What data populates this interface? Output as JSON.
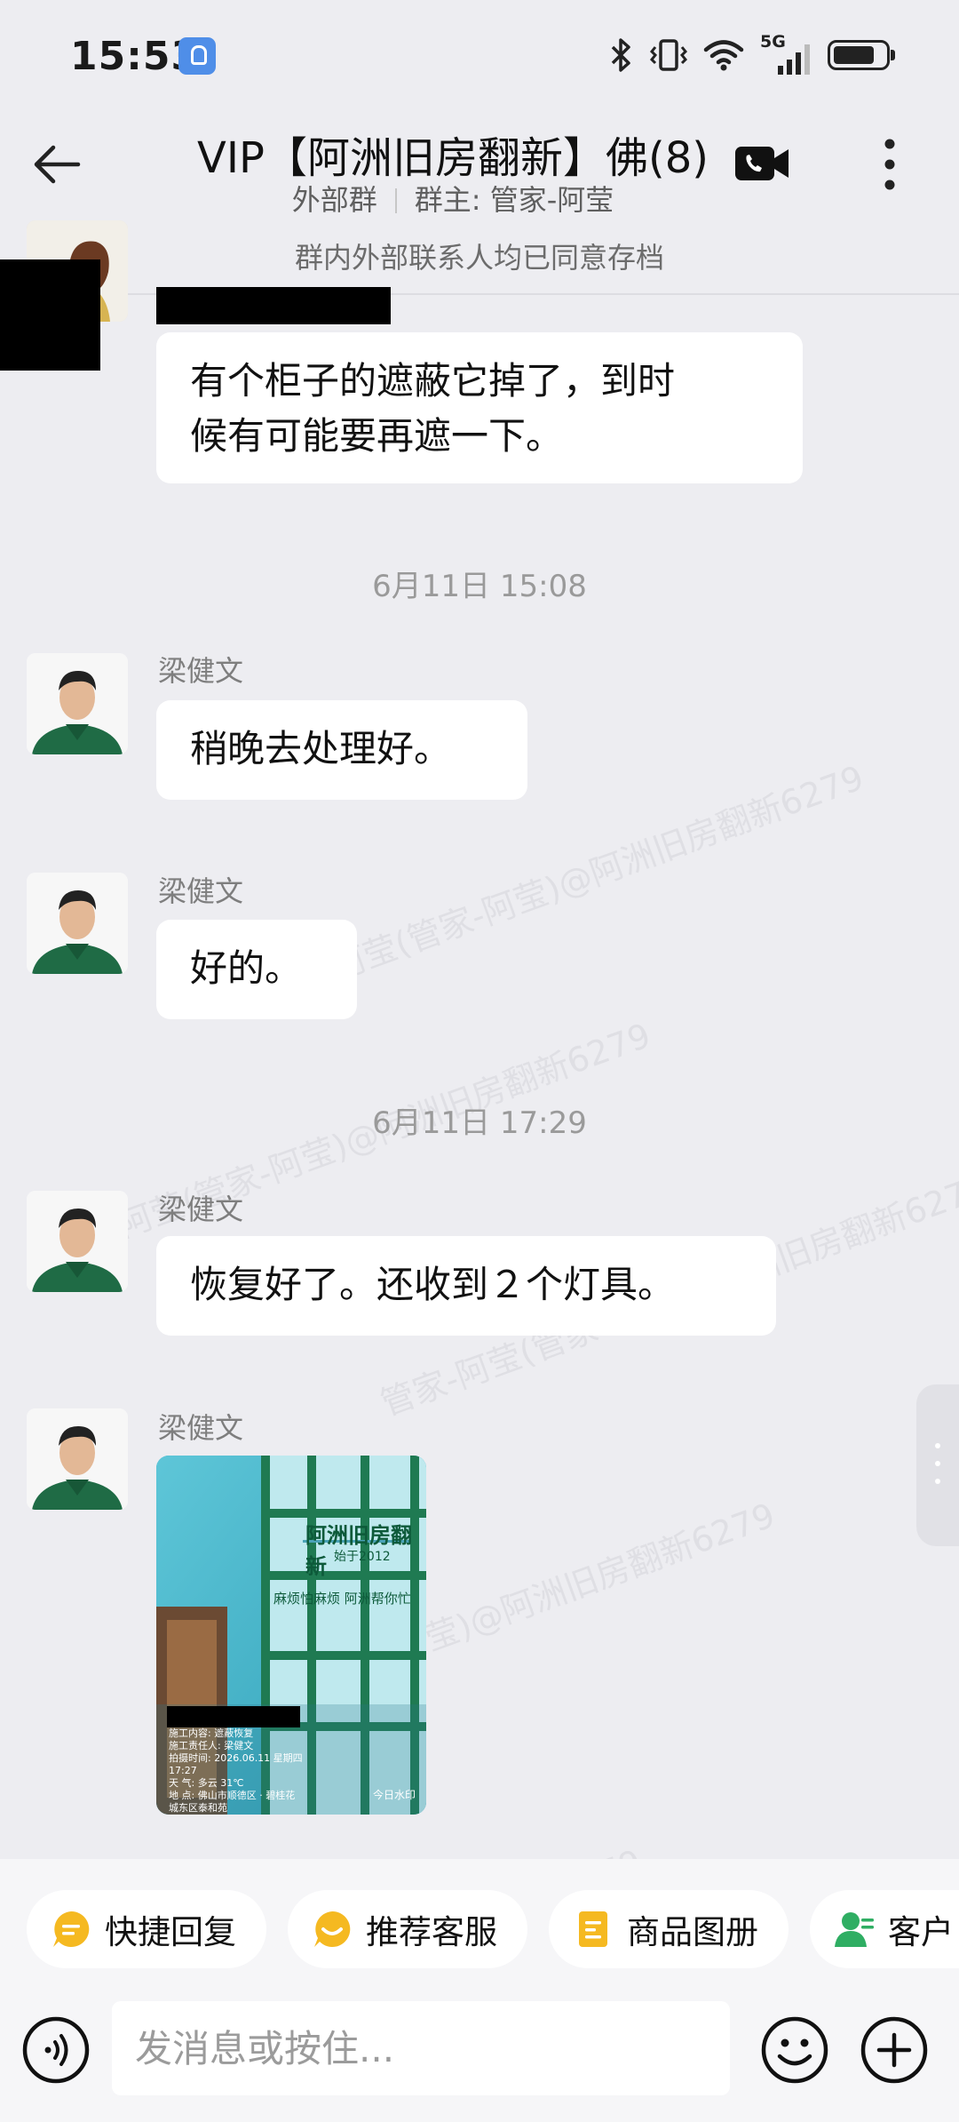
{
  "status_bar": {
    "time": "15:53",
    "network": "5G",
    "battery_level": 0.8
  },
  "header": {
    "title": "VIP【阿洲旧房翻新】佛(8)",
    "group_type": "外部群",
    "owner": "群主: 管家-阿莹"
  },
  "archive_notice": "群内外部联系人均已同意存档",
  "watermark_text": "管家-阿莹(管家-阿莹)@阿洲旧房翻新6279",
  "messages": [
    {
      "sender": "",
      "text": "有个柜子的遮蔽它掉了，到时\n候有可能要再遮一下。"
    },
    {
      "sender": "梁健文",
      "text": "稍晚去处理好。"
    },
    {
      "sender": "梁健文",
      "text": "好的。"
    },
    {
      "sender": "梁健文",
      "text": "恢复好了。还收到２个灯具。"
    },
    {
      "sender": "梁健文",
      "text": ""
    }
  ],
  "time_dividers": [
    "6月11日  15:08",
    "6月11日  17:29"
  ],
  "photo": {
    "banner_text": "阿洲旧房翻新",
    "since_text": "始于2012",
    "slogan": "麻烦怕麻烦 阿洲帮你忙",
    "caption_lines": [
      "施工内容:  遮蔽恢复",
      "施工责任人:  梁健文",
      "拍摄时间:  2026.06.11 星期四",
      "17:27",
      "天    气:  多云 31℃",
      "地    点:  佛山市顺德区 · 碧桂花",
      "城东区泰和苑"
    ],
    "stamp": "今日水印"
  },
  "quick_actions": [
    {
      "label": "快捷回复",
      "icon": "quick-reply-icon"
    },
    {
      "label": "推荐客服",
      "icon": "recommend-service-icon"
    },
    {
      "label": "商品图册",
      "icon": "product-album-icon"
    },
    {
      "label": "客户",
      "icon": "customer-icon"
    }
  ],
  "input": {
    "placeholder": "发消息或按住..."
  },
  "colors": {
    "background": "#EDEDF1",
    "bubble": "#FFFFFF",
    "chip_icon_yellow": "#F5B921",
    "customer_icon_green": "#2FAE63"
  }
}
